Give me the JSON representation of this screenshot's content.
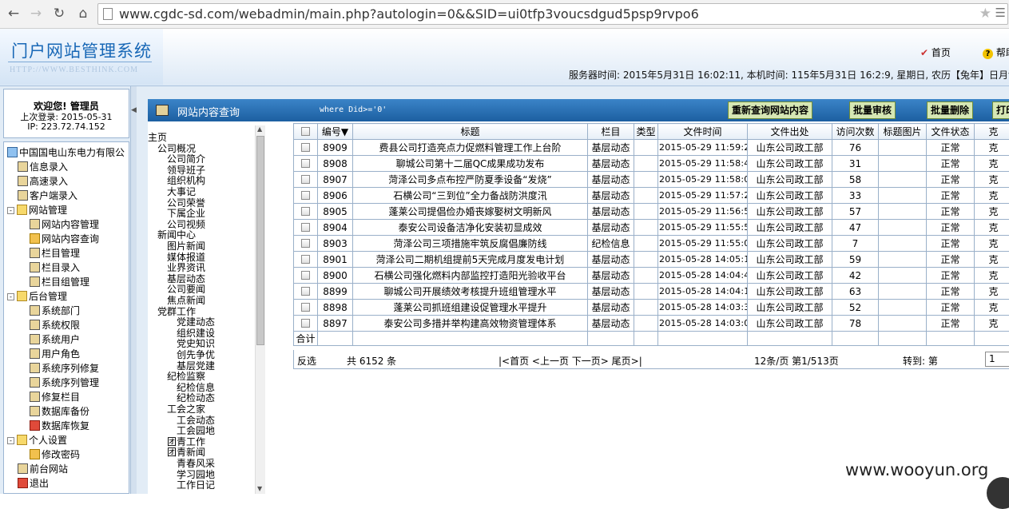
{
  "browser": {
    "url": "www.cgdc-sd.com/webadmin/main.php?autologin=0&&SID=ui0tfp3voucsdgud5psp9rvpo6",
    "back_icon": "arrow-left",
    "forward_icon": "arrow-right",
    "reload_icon": "reload",
    "home_icon": "house"
  },
  "header": {
    "title": "门户网站管理系统",
    "subtitle": "HTTP://WWW.BESTHINK.COM",
    "home_label": "首页",
    "help_label": "帮助",
    "server_time": "服务器时间: 2015年5月31日 16:02:11, 本机时间: 115年5月31日 16:2:9, 星期日, 农历【兔年】日月v"
  },
  "user": {
    "welcome": "欢迎您! 管理员",
    "last_login": "上次登录: 2015-05-31",
    "ip": "IP: 223.72.74.152"
  },
  "sidebar_tree": [
    {
      "label": "中国国电山东电力有限公",
      "level": 0,
      "icon": "house-icon"
    },
    {
      "label": "信息录入",
      "level": 1,
      "icon": "doc-icon"
    },
    {
      "label": "高速录入",
      "level": 1,
      "icon": "doc-icon"
    },
    {
      "label": "客户端录入",
      "level": 1,
      "icon": "doc-icon"
    },
    {
      "label": "网站管理",
      "level": 1,
      "icon": "folder-icon",
      "toggle": "-"
    },
    {
      "label": "网站内容管理",
      "level": 2,
      "icon": "doc-icon"
    },
    {
      "label": "网站内容查询",
      "level": 2,
      "icon": "search-icon"
    },
    {
      "label": "栏目管理",
      "level": 2,
      "icon": "doc-icon"
    },
    {
      "label": "栏目录入",
      "level": 2,
      "icon": "doc-icon"
    },
    {
      "label": "栏目组管理",
      "level": 2,
      "icon": "doc-icon"
    },
    {
      "label": "后台管理",
      "level": 1,
      "icon": "folder-icon",
      "toggle": "-"
    },
    {
      "label": "系统部门",
      "level": 2,
      "icon": "doc-icon"
    },
    {
      "label": "系统权限",
      "level": 2,
      "icon": "doc-icon"
    },
    {
      "label": "系统用户",
      "level": 2,
      "icon": "doc-icon"
    },
    {
      "label": "用户角色",
      "level": 2,
      "icon": "doc-icon"
    },
    {
      "label": "系统序列修复",
      "level": 2,
      "icon": "doc-icon"
    },
    {
      "label": "系统序列管理",
      "level": 2,
      "icon": "doc-icon"
    },
    {
      "label": "修复栏目",
      "level": 2,
      "icon": "doc-icon"
    },
    {
      "label": "数据库备份",
      "level": 2,
      "icon": "doc-icon"
    },
    {
      "label": "数据库恢复",
      "level": 2,
      "icon": "red-icon"
    },
    {
      "label": "个人设置",
      "level": 1,
      "icon": "folder-icon",
      "toggle": "-"
    },
    {
      "label": "修改密码",
      "level": 2,
      "icon": "key-icon"
    },
    {
      "label": "前台网站",
      "level": 1,
      "icon": "doc-icon"
    },
    {
      "label": "退出",
      "level": 1,
      "icon": "red-icon"
    }
  ],
  "panel": {
    "title": "网站内容查询",
    "where_clause": "where Did>='0'",
    "buttons": [
      "重新查询网站内容",
      "批量审核",
      "批量删除",
      "打印"
    ]
  },
  "column_tree": [
    {
      "label": "主页",
      "indent": 0
    },
    {
      "label": "公司概况",
      "indent": 1
    },
    {
      "label": "公司简介",
      "indent": 2
    },
    {
      "label": "领导班子",
      "indent": 2
    },
    {
      "label": "组织机构",
      "indent": 2
    },
    {
      "label": "大事记",
      "indent": 2
    },
    {
      "label": "公司荣誉",
      "indent": 2
    },
    {
      "label": "下属企业",
      "indent": 2
    },
    {
      "label": "公司视频",
      "indent": 2
    },
    {
      "label": "新闻中心",
      "indent": 1
    },
    {
      "label": "图片新闻",
      "indent": 2
    },
    {
      "label": "媒体报道",
      "indent": 2
    },
    {
      "label": "业界资讯",
      "indent": 2
    },
    {
      "label": "基层动态",
      "indent": 2
    },
    {
      "label": "公司要闻",
      "indent": 2
    },
    {
      "label": "焦点新闻",
      "indent": 2
    },
    {
      "label": "党群工作",
      "indent": 1
    },
    {
      "label": "党建动态",
      "indent": 3
    },
    {
      "label": "组织建设",
      "indent": 3
    },
    {
      "label": "党史知识",
      "indent": 3
    },
    {
      "label": "创先争优",
      "indent": 3
    },
    {
      "label": "基层党建",
      "indent": 3
    },
    {
      "label": "纪检监察",
      "indent": 2
    },
    {
      "label": "纪检信息",
      "indent": 3
    },
    {
      "label": "纪检动态",
      "indent": 3
    },
    {
      "label": "工会之家",
      "indent": 2
    },
    {
      "label": "工会动态",
      "indent": 3
    },
    {
      "label": "工会园地",
      "indent": 3
    },
    {
      "label": "团青工作",
      "indent": 2
    },
    {
      "label": "团青新闻",
      "indent": 2
    },
    {
      "label": "青春风采",
      "indent": 3
    },
    {
      "label": "学习园地",
      "indent": 3
    },
    {
      "label": "工作日记",
      "indent": 3
    }
  ],
  "table": {
    "headers": [
      "",
      "编号▼",
      "标题",
      "栏目",
      "类型",
      "文件时间",
      "文件出处",
      "访问次数",
      "标题图片",
      "文件状态",
      "克"
    ],
    "rows": [
      {
        "id": "8909",
        "title": "费县公司打造亮点力促燃料管理工作上台阶",
        "column": "基层动态",
        "type": "",
        "time": "2015-05-29 11:59:24",
        "source": "山东公司政工部",
        "visits": "76",
        "image": "",
        "status": "正常",
        "extra": "克"
      },
      {
        "id": "8908",
        "title": "聊城公司第十二届QC成果成功发布",
        "column": "基层动态",
        "type": "",
        "time": "2015-05-29 11:58:45",
        "source": "山东公司政工部",
        "visits": "31",
        "image": "",
        "status": "正常",
        "extra": "克"
      },
      {
        "id": "8907",
        "title": "菏泽公司多点布控严防夏季设备“发烧”",
        "column": "基层动态",
        "type": "",
        "time": "2015-05-29 11:58:06",
        "source": "山东公司政工部",
        "visits": "58",
        "image": "",
        "status": "正常",
        "extra": "克"
      },
      {
        "id": "8906",
        "title": "石横公司“三到位”全力备战防洪度汛",
        "column": "基层动态",
        "type": "",
        "time": "2015-05-29 11:57:29",
        "source": "山东公司政工部",
        "visits": "33",
        "image": "",
        "status": "正常",
        "extra": "克"
      },
      {
        "id": "8905",
        "title": "蓬莱公司提倡俭办婚丧嫁娶树文明新风",
        "column": "基层动态",
        "type": "",
        "time": "2015-05-29 11:56:54",
        "source": "山东公司政工部",
        "visits": "57",
        "image": "",
        "status": "正常",
        "extra": "克"
      },
      {
        "id": "8904",
        "title": "泰安公司设备洁净化安装初显成效",
        "column": "基层动态",
        "type": "",
        "time": "2015-05-29 11:55:57",
        "source": "山东公司政工部",
        "visits": "47",
        "image": "",
        "status": "正常",
        "extra": "克"
      },
      {
        "id": "8903",
        "title": "菏泽公司三项措施牢筑反腐倡廉防线",
        "column": "纪检信息",
        "type": "",
        "time": "2015-05-29 11:55:06",
        "source": "山东公司政工部",
        "visits": "7",
        "image": "",
        "status": "正常",
        "extra": "克"
      },
      {
        "id": "8901",
        "title": "菏泽公司二期机组提前5天完成月度发电计划",
        "column": "基层动态",
        "type": "",
        "time": "2015-05-28 14:05:18",
        "source": "山东公司政工部",
        "visits": "59",
        "image": "",
        "status": "正常",
        "extra": "克"
      },
      {
        "id": "8900",
        "title": "石横公司强化燃料内部监控打造阳光验收平台",
        "column": "基层动态",
        "type": "",
        "time": "2015-05-28 14:04:46",
        "source": "山东公司政工部",
        "visits": "42",
        "image": "",
        "status": "正常",
        "extra": "克"
      },
      {
        "id": "8899",
        "title": "聊城公司开展绩效考核提升班组管理水平",
        "column": "基层动态",
        "type": "",
        "time": "2015-05-28 14:04:12",
        "source": "山东公司政工部",
        "visits": "63",
        "image": "",
        "status": "正常",
        "extra": "克"
      },
      {
        "id": "8898",
        "title": "蓬莱公司抓班组建设促管理水平提升",
        "column": "基层动态",
        "type": "",
        "time": "2015-05-28 14:03:37",
        "source": "山东公司政工部",
        "visits": "52",
        "image": "",
        "status": "正常",
        "extra": "克"
      },
      {
        "id": "8897",
        "title": "泰安公司多措并举构建高效物资管理体系",
        "column": "基层动态",
        "type": "",
        "time": "2015-05-28 14:03:01",
        "source": "山东公司政工部",
        "visits": "78",
        "image": "",
        "status": "正常",
        "extra": "克"
      }
    ],
    "total_label": "合计"
  },
  "pager": {
    "invert_label": "反选",
    "total": "共 6152 条",
    "nav": "|<首页 <上一页 下一页> 尾页>|",
    "per_page": "12条/页 第1/513页",
    "goto_label": "转到: 第",
    "goto_value": "1"
  },
  "watermark": "www.wooyun.org"
}
